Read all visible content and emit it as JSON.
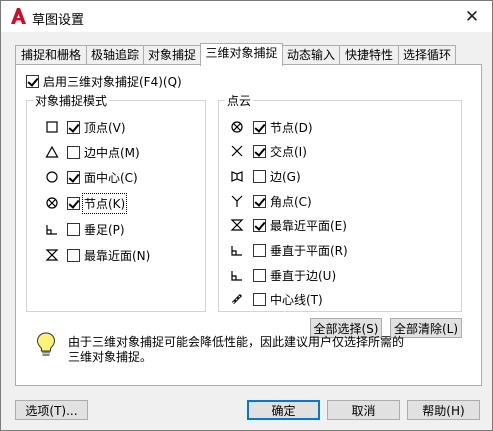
{
  "window": {
    "title": "草图设置",
    "close_glyph": "✕",
    "brand_color": "#c8102e"
  },
  "tabs": [
    {
      "label": "捕捉和栅格"
    },
    {
      "label": "极轴追踪"
    },
    {
      "label": "对象捕捉"
    },
    {
      "label": "三维对象捕捉",
      "active": true
    },
    {
      "label": "动态输入"
    },
    {
      "label": "快捷特性"
    },
    {
      "label": "选择循环"
    }
  ],
  "enable_3d_osnap": {
    "label": "启用三维对象捕捉(F4)(Q)",
    "checked": true
  },
  "osnap_modes": {
    "title": "对象捕捉模式",
    "items": [
      {
        "icon": "square-marker-icon",
        "label": "顶点(V)",
        "checked": true
      },
      {
        "icon": "triangle-marker-icon",
        "label": "边中点(M)",
        "checked": false
      },
      {
        "icon": "circle-marker-icon",
        "label": "面中心(C)",
        "checked": true
      },
      {
        "icon": "node-marker-icon",
        "label": "节点(K)",
        "checked": true
      },
      {
        "icon": "perpendicular-marker-icon",
        "label": "垂足(P)",
        "checked": false
      },
      {
        "icon": "nearest-marker-icon",
        "label": "最靠近面(N)",
        "checked": false
      }
    ]
  },
  "point_cloud": {
    "title": "点云",
    "items": [
      {
        "icon": "node-marker-icon",
        "label": "节点(D)",
        "checked": true
      },
      {
        "icon": "intersection-marker-icon",
        "label": "交点(I)",
        "checked": true
      },
      {
        "icon": "edge-marker-icon",
        "label": "边(G)",
        "checked": false
      },
      {
        "icon": "corner-marker-icon",
        "label": "角点(C)",
        "checked": true
      },
      {
        "icon": "nearest-marker-icon",
        "label": "最靠近平面(E)",
        "checked": true
      },
      {
        "icon": "perpendicular-marker-icon",
        "label": "垂直于平面(R)",
        "checked": false
      },
      {
        "icon": "perpendicular-marker-icon",
        "label": "垂直于边(U)",
        "checked": false
      },
      {
        "icon": "centerline-marker-icon",
        "label": "中心线(T)",
        "checked": false
      }
    ]
  },
  "select_all_label": "全部选择(S)",
  "clear_all_label": "全部清除(L)",
  "info": {
    "icon": "lightbulb-icon",
    "line1": "由于三维对象捕捉可能会降低性能，因此建议用户仅选择所需的",
    "line2": "三维对象捕捉。"
  },
  "footer": {
    "options_label": "选项(T)...",
    "ok_label": "确定",
    "cancel_label": "取消",
    "help_label": "帮助(H)"
  }
}
